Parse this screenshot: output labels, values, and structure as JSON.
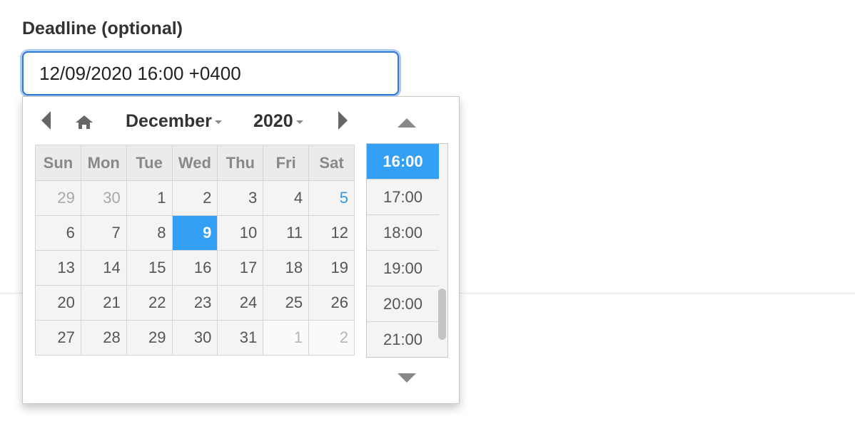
{
  "deadline": {
    "label": "Deadline (optional)",
    "value": "12/09/2020 16:00 +0400"
  },
  "picker": {
    "month": "December",
    "year": "2020",
    "weekdays": [
      "Sun",
      "Mon",
      "Tue",
      "Wed",
      "Thu",
      "Fri",
      "Sat"
    ],
    "weeks": [
      [
        "29",
        "30",
        "1",
        "2",
        "3",
        "4",
        "5"
      ],
      [
        "6",
        "7",
        "8",
        "9",
        "10",
        "11",
        "12"
      ],
      [
        "13",
        "14",
        "15",
        "16",
        "17",
        "18",
        "19"
      ],
      [
        "20",
        "21",
        "22",
        "23",
        "24",
        "25",
        "26"
      ],
      [
        "27",
        "28",
        "29",
        "30",
        "31",
        "1",
        "2"
      ]
    ],
    "selected_day": "9",
    "times": [
      "16:00",
      "17:00",
      "18:00",
      "19:00",
      "20:00",
      "21:00"
    ],
    "selected_time": "16:00",
    "colors": {
      "selected": "#33a0f5",
      "weekend_highlight": "#3399e6"
    },
    "icons": [
      "prev-month-icon",
      "home-icon",
      "next-month-icon",
      "time-up-icon",
      "time-down-icon"
    ]
  }
}
